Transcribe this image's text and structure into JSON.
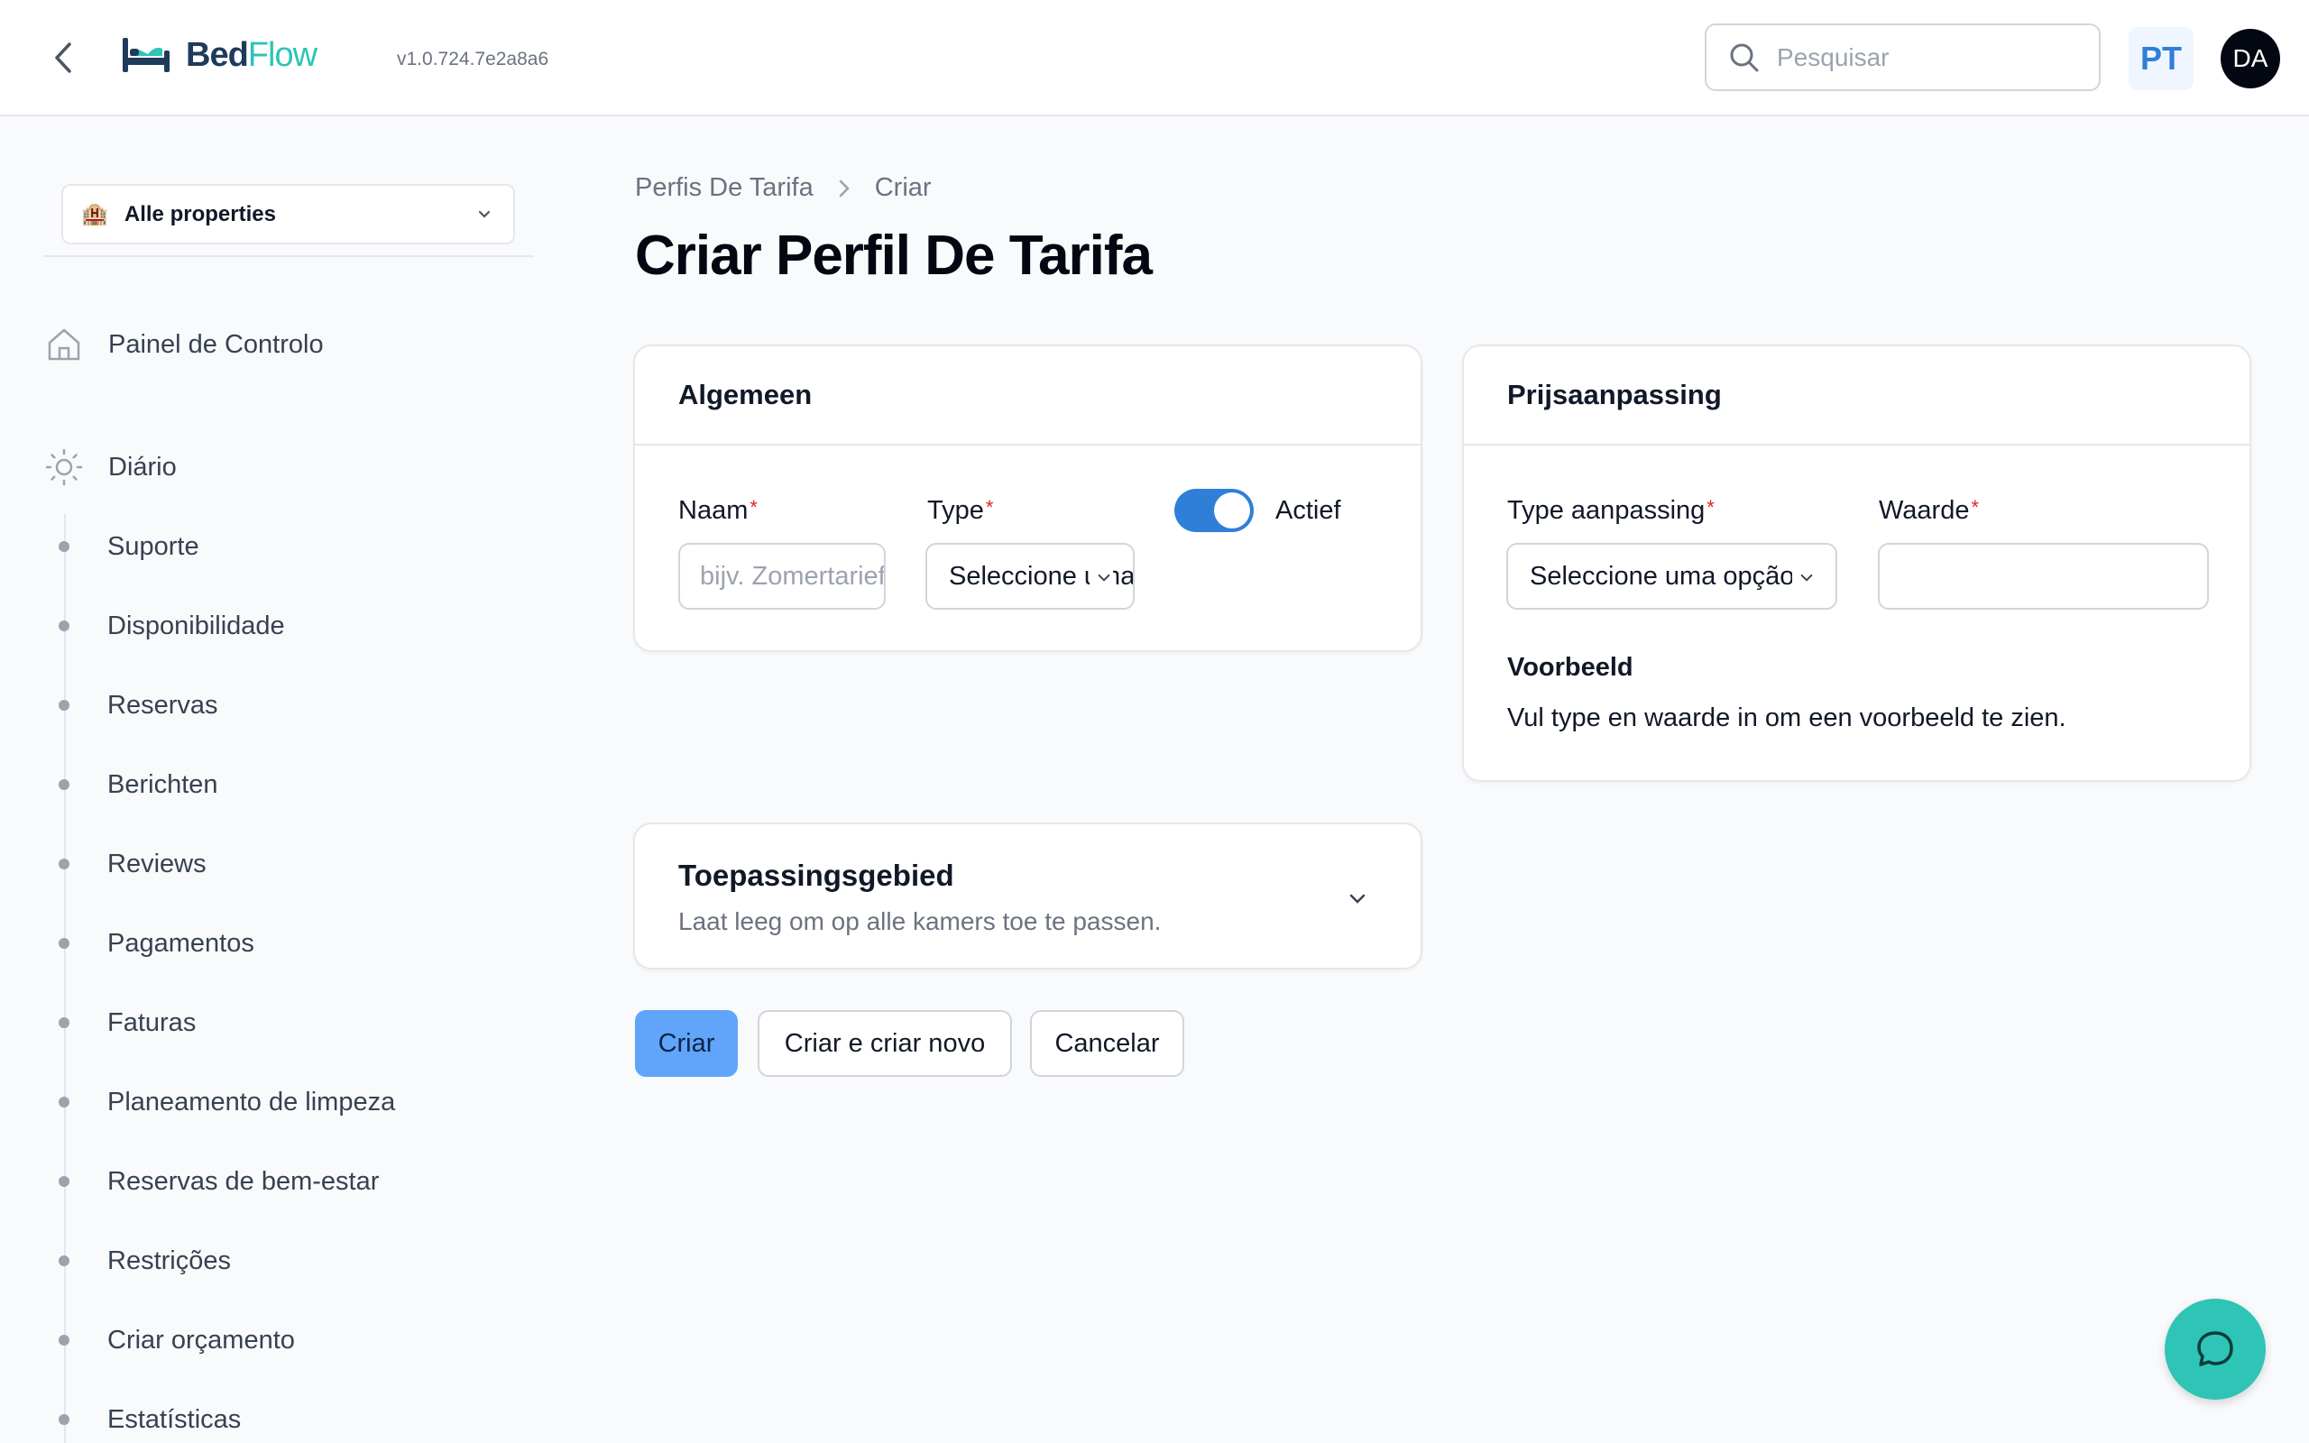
{
  "header": {
    "logo_part1": "Bed",
    "logo_part2": "Flow",
    "version": "v1.0.724.7e2a8a6",
    "search_placeholder": "Pesquisar",
    "language": "PT",
    "user_initials": "DA"
  },
  "sidebar": {
    "property_selector": "Alle properties",
    "dashboard": "Painel de Controlo",
    "group_label": "Diário",
    "items": [
      {
        "label": "Suporte"
      },
      {
        "label": "Disponibilidade"
      },
      {
        "label": "Reservas"
      },
      {
        "label": "Berichten"
      },
      {
        "label": "Reviews"
      },
      {
        "label": "Pagamentos"
      },
      {
        "label": "Faturas"
      },
      {
        "label": "Planeamento de limpeza"
      },
      {
        "label": "Reservas de bem-estar"
      },
      {
        "label": "Restrições"
      },
      {
        "label": "Criar orçamento"
      },
      {
        "label": "Estatísticas"
      }
    ]
  },
  "breadcrumb": {
    "parent": "Perfis De Tarifa",
    "current": "Criar"
  },
  "page_title": "Criar Perfil De Tarifa",
  "general_card": {
    "title": "Algemeen",
    "name_label": "Naam",
    "name_placeholder": "bijv. Zomertarief",
    "type_label": "Type",
    "type_value": "Seleccione uma opção",
    "active_label": "Actief",
    "active": true
  },
  "price_card": {
    "title": "Prijsaanpassing",
    "adjust_type_label": "Type aanpassing",
    "adjust_type_value": "Seleccione uma opção",
    "value_label": "Waarde",
    "value": "",
    "preview_title": "Voorbeeld",
    "preview_text": "Vul type en waarde in om een voorbeeld te zien."
  },
  "scope_card": {
    "title": "Toepassingsgebied",
    "description": "Laat leeg om op alle kamers toe te passen."
  },
  "actions": {
    "create": "Criar",
    "create_another": "Criar e criar novo",
    "cancel": "Cancelar"
  },
  "colors": {
    "primary": "#2f7fd8",
    "primary_button": "#60a5fa",
    "brand_teal": "#2ec4b6",
    "brand_navy": "#1f3b5c"
  }
}
